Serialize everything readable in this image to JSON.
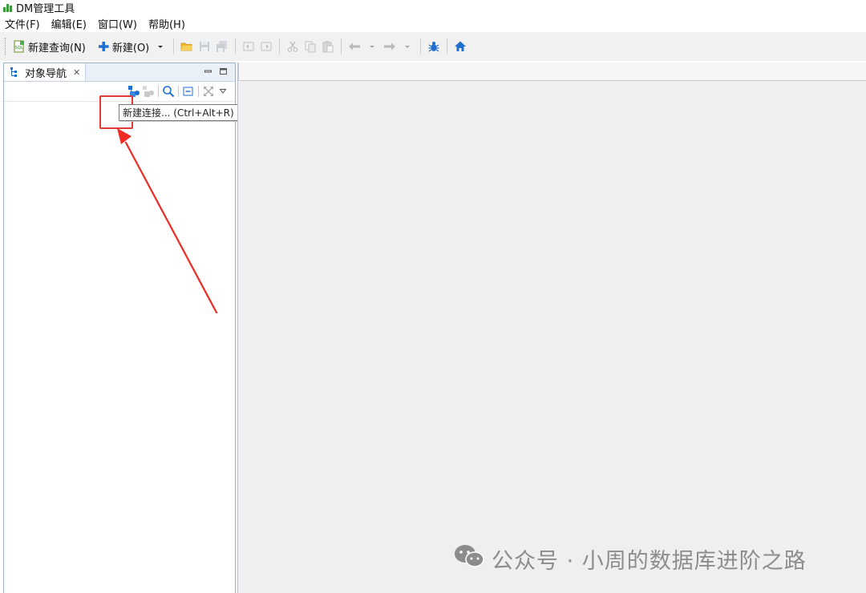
{
  "window": {
    "title": "DM管理工具",
    "app_icon": "dm-app-icon"
  },
  "menu": [
    {
      "label": "文件(F)"
    },
    {
      "label": "编辑(E)"
    },
    {
      "label": "窗口(W)"
    },
    {
      "label": "帮助(H)"
    }
  ],
  "toolbar": {
    "new_query_label": "新建查询(N)",
    "new_label": "新建(O)",
    "icons": [
      "sql-new-query-icon",
      "plus-icon",
      "dropdown-arrow-icon",
      "open-folder-icon",
      "save-icon",
      "save-all-icon",
      "undo-icon",
      "redo-icon",
      "cut-icon",
      "copy-icon",
      "paste-icon",
      "back-arrow-icon",
      "forward-arrow-icon",
      "debug-bug-icon",
      "home-icon"
    ]
  },
  "nav_panel": {
    "tab_label": "对象导航",
    "tab_close": "✕",
    "tooltip": "新建连接... (Ctrl+Alt+R)"
  },
  "watermark": {
    "text": "公众号 · 小周的数据库进阶之路"
  },
  "colors": {
    "accent_blue": "#1e6fd0",
    "highlight_red": "#e53935",
    "folder_yellow": "#f2b632",
    "toolbar_bg": "#f1f1f1",
    "editor_bg": "#efefef"
  }
}
